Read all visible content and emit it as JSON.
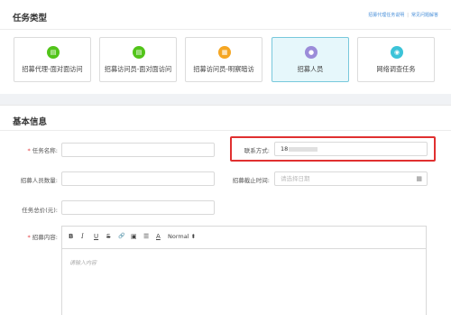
{
  "task_type": {
    "title": "任务类型",
    "links": [
      "招募代理任务说明",
      "常见问题解答"
    ],
    "cards": [
      {
        "label": "招募代理-面对面访问",
        "icon": "document-icon",
        "icon_color": "#52c41a",
        "active": false
      },
      {
        "label": "招募访问员-面对面访问",
        "icon": "document-icon",
        "icon_color": "#52c41a",
        "active": false
      },
      {
        "label": "招募访问员-明察暗访",
        "icon": "clipboard-icon",
        "icon_color": "#f5a623",
        "active": false
      },
      {
        "label": "招募人员",
        "icon": "people-icon",
        "icon_color": "#9b8cd9",
        "active": true
      },
      {
        "label": "网络调查任务",
        "icon": "globe-icon",
        "icon_color": "#3cc3d8",
        "active": false
      }
    ]
  },
  "basic_info": {
    "title": "基本信息",
    "task_name": {
      "label": "任务名称:",
      "required": true,
      "value": ""
    },
    "contact": {
      "label": "联系方式:",
      "value": "18"
    },
    "recruit_count": {
      "label": "招募人员数量:",
      "value": ""
    },
    "deadline": {
      "label": "招募截止时间:",
      "placeholder": "请选择日期"
    },
    "total_price": {
      "label": "任务总价(元):",
      "value": ""
    },
    "content": {
      "label": "招募内容:",
      "required": true,
      "placeholder": "请输入内容"
    }
  },
  "editor_toolbar": {
    "buttons": [
      {
        "name": "bold",
        "glyph": "B"
      },
      {
        "name": "italic",
        "glyph": "I"
      },
      {
        "name": "underline",
        "glyph": "U"
      },
      {
        "name": "strike",
        "glyph": "S"
      },
      {
        "name": "link",
        "glyph": "🔗"
      },
      {
        "name": "image",
        "glyph": "▣"
      },
      {
        "name": "list",
        "glyph": "☰"
      },
      {
        "name": "color",
        "glyph": "A"
      }
    ],
    "format": "Normal",
    "format_arrow": "⬍"
  },
  "colors": {
    "accent": "#4a90d9",
    "required": "#e4393c",
    "highlight_box": "#e03030"
  }
}
